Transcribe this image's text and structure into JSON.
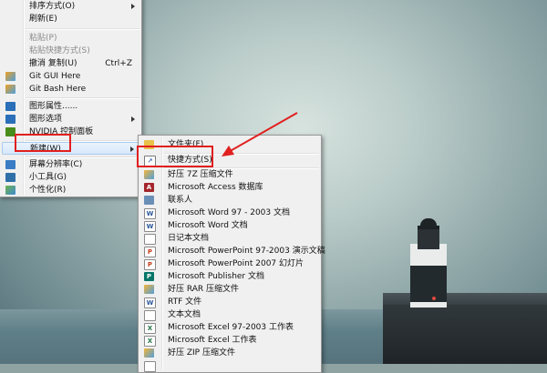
{
  "context_menu": {
    "items": [
      {
        "label": "排序方式(O)",
        "submenu": true
      },
      {
        "label": "刷新(E)"
      },
      {
        "label": "粘贴(P)",
        "disabled": true
      },
      {
        "label": "粘贴快捷方式(S)",
        "disabled": true
      },
      {
        "label": "撤消 复制(U)",
        "shortcut": "Ctrl+Z"
      },
      {
        "label": "Git GUI Here",
        "icon": "git-gui-icon"
      },
      {
        "label": "Git Bash Here",
        "icon": "git-bash-icon"
      },
      {
        "label": "图形属性......",
        "icon": "graphics-properties-icon"
      },
      {
        "label": "图形选项",
        "icon": "graphics-options-icon",
        "submenu": true
      },
      {
        "label": "NVIDIA 控制面板",
        "icon": "nvidia-icon"
      },
      {
        "label": "新建(W)",
        "submenu": true,
        "active": true
      },
      {
        "label": "屏幕分辨率(C)",
        "icon": "display-icon"
      },
      {
        "label": "小工具(G)",
        "icon": "gadgets-icon"
      },
      {
        "label": "个性化(R)",
        "icon": "personalize-icon"
      }
    ]
  },
  "new_submenu": {
    "items": [
      {
        "label": "文件夹(F)",
        "icon": "folder-icon"
      },
      {
        "label": "快捷方式(S)",
        "icon": "shortcut-icon"
      },
      {
        "label": "好压 7Z 压缩文件",
        "icon": "haozip-7z-icon"
      },
      {
        "label": "Microsoft Access 数据库",
        "icon": "access-icon"
      },
      {
        "label": "联系人",
        "icon": "contact-icon"
      },
      {
        "label": "Microsoft Word 97 - 2003 文档",
        "icon": "word97-icon"
      },
      {
        "label": "Microsoft Word 文档",
        "icon": "word-icon"
      },
      {
        "label": "日记本文档",
        "icon": "journal-icon"
      },
      {
        "label": "Microsoft PowerPoint 97-2003 演示文稿",
        "icon": "ppt97-icon"
      },
      {
        "label": "Microsoft PowerPoint 2007 幻灯片",
        "icon": "ppt2007-icon"
      },
      {
        "label": "Microsoft Publisher 文档",
        "icon": "publisher-icon"
      },
      {
        "label": "好压 RAR 压缩文件",
        "icon": "haozip-rar-icon"
      },
      {
        "label": "RTF 文件",
        "icon": "rtf-icon"
      },
      {
        "label": "文本文档",
        "icon": "text-doc-icon"
      },
      {
        "label": "Microsoft Excel 97-2003 工作表",
        "icon": "excel97-icon"
      },
      {
        "label": "Microsoft Excel 工作表",
        "icon": "excel-icon"
      },
      {
        "label": "好压 ZIP 压缩文件",
        "icon": "haozip-zip-icon"
      }
    ]
  },
  "colors": {
    "highlight": "#e11f1f",
    "menu_bg": "#f0f0f0"
  }
}
